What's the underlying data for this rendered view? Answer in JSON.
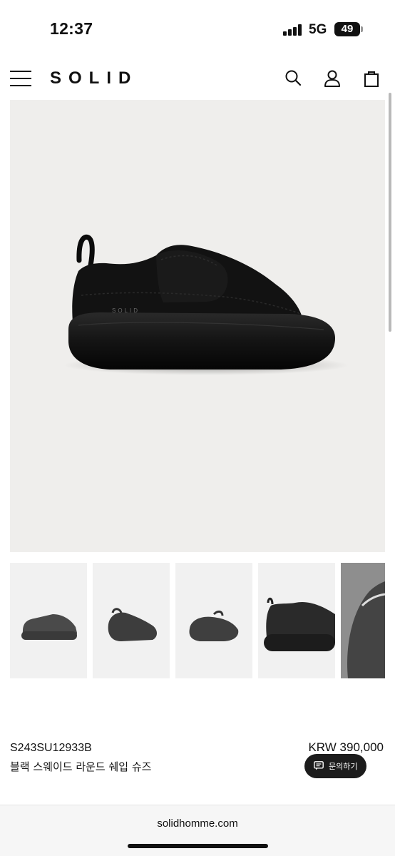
{
  "status_bar": {
    "time": "12:37",
    "network": "5G",
    "battery": "49",
    "icons": [
      "signal-bars-icon",
      "battery-icon"
    ]
  },
  "header": {
    "logo": "SOLID",
    "icons": [
      "hamburger-menu-icon",
      "search-icon",
      "account-icon",
      "shopping-bag-icon"
    ]
  },
  "product": {
    "sku": "S243SU12933B",
    "name": "블랙 스웨이드 라운드 쉐입 슈즈",
    "price": "KRW 390,000",
    "shoe_logo": "SOLID",
    "inquiry_label": "문의하기"
  },
  "gallery": {
    "thumbnail_count": 5
  },
  "browser": {
    "url": "solidhomme.com"
  }
}
